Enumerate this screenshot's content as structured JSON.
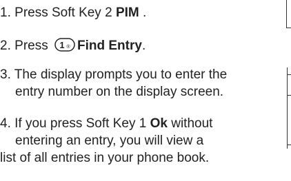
{
  "steps": [
    {
      "number": "1.",
      "text_before": "Press Soft Key 2 ",
      "bold": "PIM",
      "text_after": " ."
    },
    {
      "number": "2.",
      "text_before": "Press ",
      "icon": "key-1-icon",
      "icon_digit": "1",
      "bold": "Find Entry",
      "text_after": "."
    },
    {
      "number": "3.",
      "line1": "The display prompts you to enter the",
      "line2": "entry number on the display screen."
    },
    {
      "number": "4.",
      "line1_before": "If you press Soft Key 1 ",
      "line1_bold": "Ok",
      "line1_after": " without",
      "line2": "entering an entry, you will view a",
      "line3": "list of all entries in your phone book."
    }
  ]
}
